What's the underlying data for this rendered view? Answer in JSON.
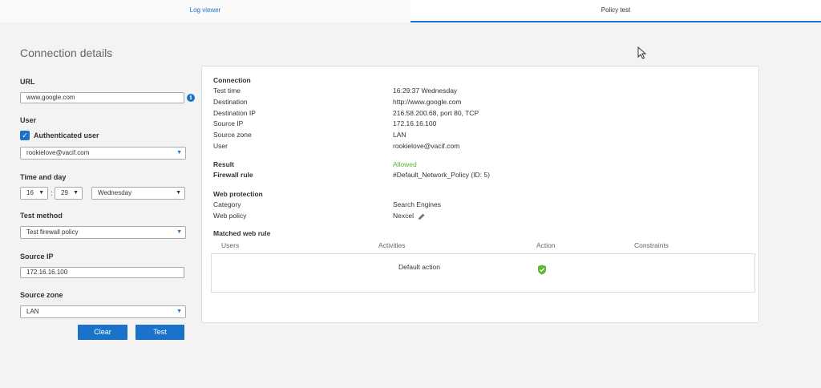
{
  "tabs": {
    "log_viewer": "Log viewer",
    "policy_test": "Policy test"
  },
  "form": {
    "title": "Connection details",
    "url_label": "URL",
    "url_value": "www.google.com",
    "user_label": "User",
    "authenticated_label": "Authenticated user",
    "authenticated_checked": true,
    "user_value": "rookielove@vacif.com",
    "time_label": "Time and day",
    "hour": "16",
    "minute": "29",
    "time_separator": ":",
    "day": "Wednesday",
    "method_label": "Test method",
    "method_value": "Test firewall policy",
    "source_ip_label": "Source IP",
    "source_ip_value": "172.16.16.100",
    "source_zone_label": "Source zone",
    "source_zone_value": "LAN",
    "clear_label": "Clear",
    "test_label": "Test"
  },
  "result": {
    "connection_heading": "Connection",
    "rows": [
      {
        "key": "Test time",
        "value": "16:29:37 Wednesday"
      },
      {
        "key": "Destination",
        "value": "http://www.google.com"
      },
      {
        "key": "Destination IP",
        "value": "216.58.200.68, port 80, TCP"
      },
      {
        "key": "Source IP",
        "value": "172.16.16.100"
      },
      {
        "key": "Source zone",
        "value": "LAN"
      },
      {
        "key": "User",
        "value": "rookielove@vacif.com"
      }
    ],
    "result_label": "Result",
    "result_value": "Allowed",
    "firewall_label": "Firewall rule",
    "firewall_value": "#Default_Network_Policy (ID: 5)",
    "web_heading": "Web protection",
    "category_label": "Category",
    "category_value": "Search Engines",
    "policy_label": "Web policy",
    "policy_value": "Nexcel",
    "matched_heading": "Matched web rule",
    "table_headers": {
      "users": "Users",
      "activities": "Activities",
      "action": "Action",
      "constraints": "Constraints"
    },
    "table_row": {
      "activity": "Default action"
    }
  },
  "colors": {
    "accent": "#1a73c8",
    "allowed": "#5ab831"
  },
  "icons": [
    "info-icon",
    "check-icon",
    "chevron-down-icon",
    "edit-icon",
    "shield-check-icon",
    "cursor-icon"
  ]
}
